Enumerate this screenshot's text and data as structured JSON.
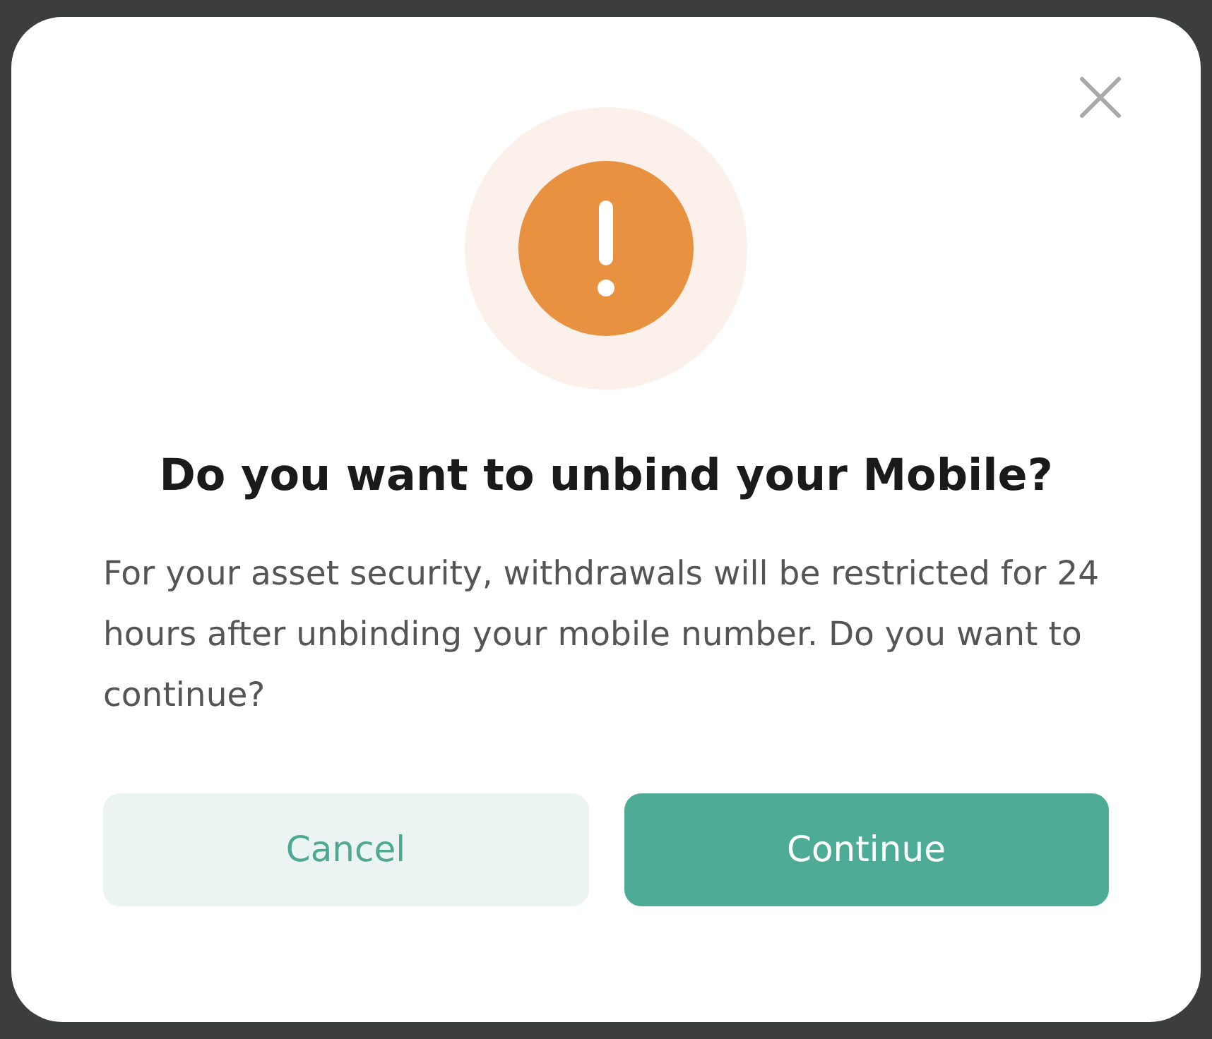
{
  "dialog": {
    "title": "Do you want to unbind your Mobile?",
    "message": "For your asset security, withdrawals will be restricted for 24 hours after unbinding your mobile number. Do you want to continue?",
    "buttons": [
      {
        "label": "Cancel",
        "kind": "secondary"
      },
      {
        "label": "Continue",
        "kind": "primary"
      }
    ]
  }
}
